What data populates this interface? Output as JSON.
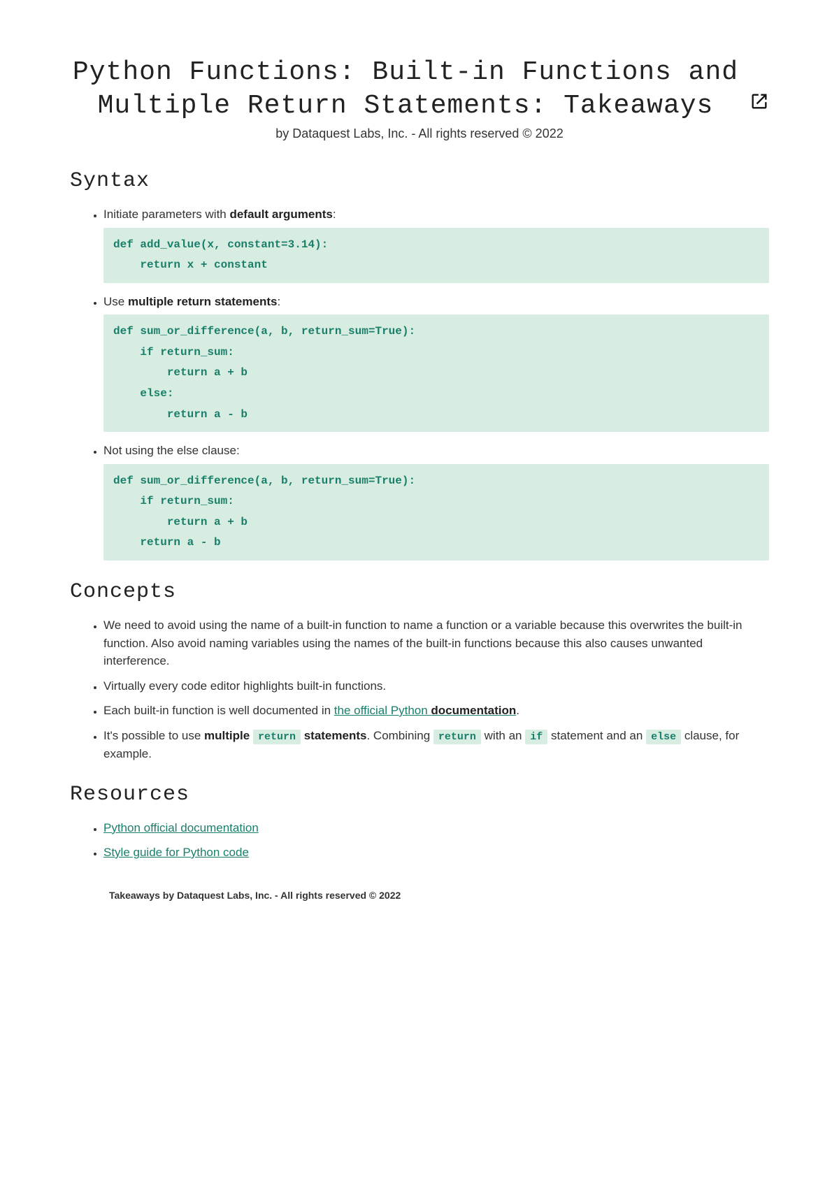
{
  "header": {
    "title": "Python Functions: Built-in Functions and Multiple Return Statements: Takeaways",
    "byline": "by Dataquest Labs, Inc. - All rights reserved © 2022"
  },
  "sections": {
    "syntax": {
      "heading": "Syntax",
      "items": [
        {
          "text_pre": "Initiate parameters with ",
          "bold": "default arguments",
          "text_post": ":",
          "code": "def add_value(x, constant=3.14):\n    return x + constant"
        },
        {
          "text_pre": "Use ",
          "bold": "multiple return statements",
          "text_post": ":",
          "code": "def sum_or_difference(a, b, return_sum=True):\n    if return_sum:\n        return a + b\n    else:\n        return a - b"
        },
        {
          "text_pre": "Not using the else clause:",
          "bold": "",
          "text_post": "",
          "code": "def sum_or_difference(a, b, return_sum=True):\n    if return_sum:\n        return a + b\n    return a - b"
        }
      ]
    },
    "concepts": {
      "heading": "Concepts",
      "item1": "We need to avoid using the name of a built-in function to name a function or a variable because this overwrites the built-in function. Also avoid naming variables using the names of the built-in functions because this also causes unwanted interference.",
      "item2": "Virtually every code editor highlights built-in functions.",
      "item3_pre": "Each built-in function is well documented in ",
      "item3_link_a": "the official Python ",
      "item3_link_b": "documentation",
      "item3_post": ".",
      "item4_a": "It's possible to use ",
      "item4_bold1": "multiple",
      "item4_code1": "return",
      "item4_bold2": "statements",
      "item4_b": ". Combining ",
      "item4_code2": "return",
      "item4_c": " with an ",
      "item4_code3": "if",
      "item4_d": " statement and an ",
      "item4_code4": "else",
      "item4_e": " clause, for example."
    },
    "resources": {
      "heading": "Resources",
      "links": [
        "Python official documentation",
        "Style guide for Python code"
      ]
    }
  },
  "footer": "Takeaways by Dataquest Labs, Inc. - All rights reserved © 2022"
}
